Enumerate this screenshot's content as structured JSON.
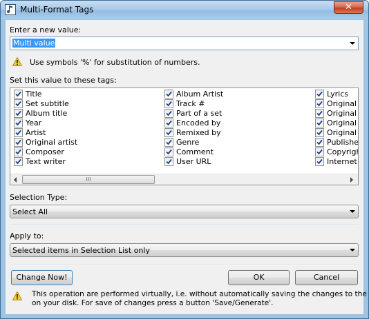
{
  "window": {
    "title": "Multi-Format Tags",
    "close_symbol": "✕"
  },
  "new_value": {
    "label": "Enter a new value:",
    "value": "Multi value",
    "hint": "Use symbols '%' for substitution of numbers."
  },
  "tags": {
    "label": "Set this value to these tags:",
    "columns": [
      [
        "Title",
        "Set subtitle",
        "Album title",
        "Year",
        "Artist",
        "Original artist",
        "Composer",
        "Text writer"
      ],
      [
        "Album Artist",
        "Track #",
        "Part of a set",
        "Encoded by",
        "Remixed by",
        "Genre",
        "Comment",
        "User URL"
      ],
      [
        "Lyrics",
        "Original al",
        "Original te",
        "Original ye",
        "Original fil",
        "Publisher",
        "Copyright",
        "Internet r"
      ]
    ],
    "scroll_thumb_grip": "III"
  },
  "selection_type": {
    "label": "Selection Type:",
    "value": "Select All"
  },
  "apply_to": {
    "label": "Apply to:",
    "value": "Selected items in Selection List only"
  },
  "buttons": {
    "change_now": "Change Now!",
    "ok": "OK",
    "cancel": "Cancel"
  },
  "footer_note": {
    "line1": "This operation are performed virtually, i.e. without automatically saving the changes to the files",
    "line2": "on your disk. For save of changes press a button 'Save/Generate'."
  }
}
